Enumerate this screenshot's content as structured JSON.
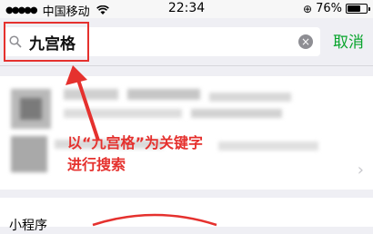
{
  "status_bar": {
    "carrier": "中国移动",
    "time": "22:34",
    "battery": "76%",
    "battery_level": 0.76,
    "icons": [
      "signal-icon",
      "wifi-icon",
      "orientation-lock-icon",
      "battery-icon"
    ]
  },
  "search": {
    "query": "九宫格",
    "cancel_label": "取消"
  },
  "annotation": {
    "line1": "以“九宫格”为关键字",
    "line2": "进行搜索"
  },
  "section": {
    "title": "小程序"
  },
  "colors": {
    "accent_green": "#07a42b",
    "annotation_red": "#e5312e",
    "background": "#efeff4"
  }
}
